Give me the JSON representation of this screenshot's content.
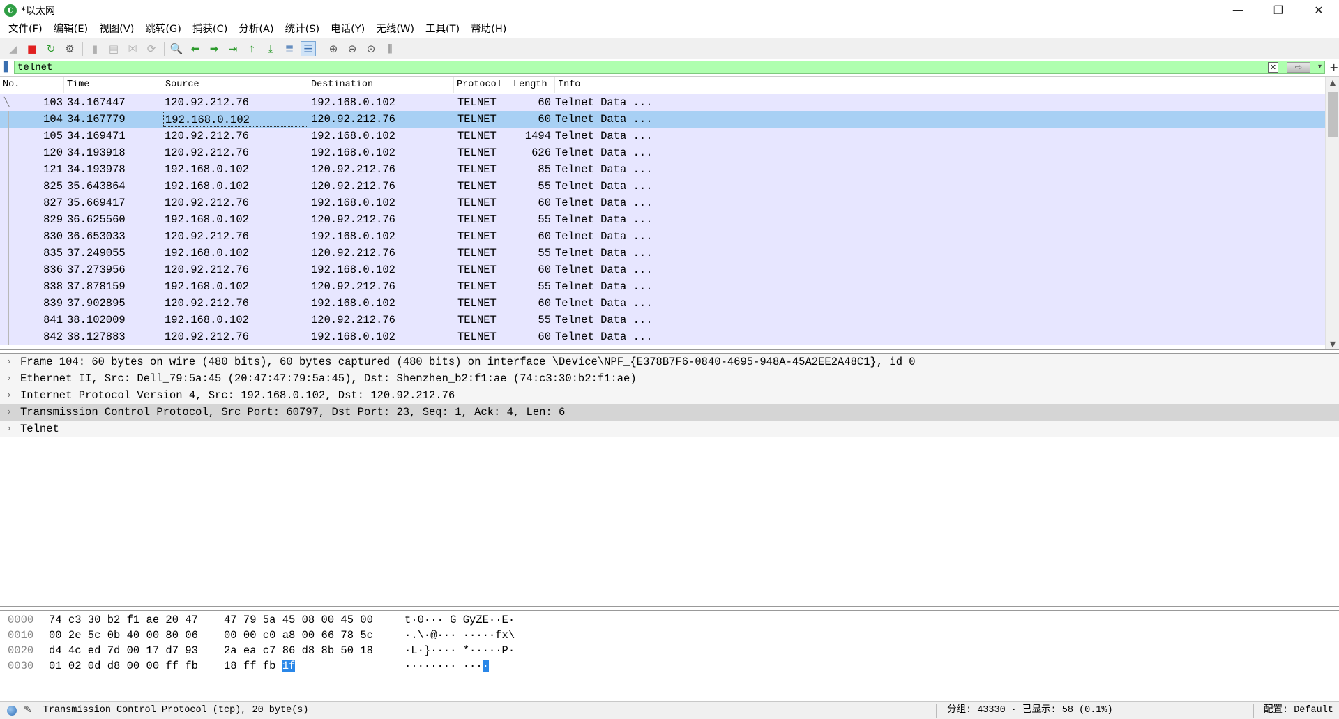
{
  "window": {
    "title": "*以太网",
    "app_icon_glyph": "◐",
    "minimize_glyph": "—",
    "restore_glyph": "❐",
    "close_glyph": "✕"
  },
  "menu": [
    "文件(F)",
    "编辑(E)",
    "视图(V)",
    "跳转(G)",
    "捕获(C)",
    "分析(A)",
    "统计(S)",
    "电话(Y)",
    "无线(W)",
    "工具(T)",
    "帮助(H)"
  ],
  "filter": {
    "value": "telnet",
    "clear_glyph": "✕",
    "apply_glyph": "⇨",
    "dropdown_glyph": "▾",
    "add_glyph": "+"
  },
  "packet_list": {
    "columns": [
      "No.",
      "Time",
      "Source",
      "Destination",
      "Protocol",
      "Length",
      "Info"
    ],
    "rows": [
      {
        "no": "103",
        "time": "34.167447",
        "src": "120.92.212.76",
        "dst": "192.168.0.102",
        "proto": "TELNET",
        "len": "60",
        "info": "Telnet Data ..."
      },
      {
        "no": "104",
        "time": "34.167779",
        "src": "192.168.0.102",
        "dst": "120.92.212.76",
        "proto": "TELNET",
        "len": "60",
        "info": "Telnet Data ..."
      },
      {
        "no": "105",
        "time": "34.169471",
        "src": "120.92.212.76",
        "dst": "192.168.0.102",
        "proto": "TELNET",
        "len": "1494",
        "info": "Telnet Data ..."
      },
      {
        "no": "120",
        "time": "34.193918",
        "src": "120.92.212.76",
        "dst": "192.168.0.102",
        "proto": "TELNET",
        "len": "626",
        "info": "Telnet Data ..."
      },
      {
        "no": "121",
        "time": "34.193978",
        "src": "192.168.0.102",
        "dst": "120.92.212.76",
        "proto": "TELNET",
        "len": "85",
        "info": "Telnet Data ..."
      },
      {
        "no": "825",
        "time": "35.643864",
        "src": "192.168.0.102",
        "dst": "120.92.212.76",
        "proto": "TELNET",
        "len": "55",
        "info": "Telnet Data ..."
      },
      {
        "no": "827",
        "time": "35.669417",
        "src": "120.92.212.76",
        "dst": "192.168.0.102",
        "proto": "TELNET",
        "len": "60",
        "info": "Telnet Data ..."
      },
      {
        "no": "829",
        "time": "36.625560",
        "src": "192.168.0.102",
        "dst": "120.92.212.76",
        "proto": "TELNET",
        "len": "55",
        "info": "Telnet Data ..."
      },
      {
        "no": "830",
        "time": "36.653033",
        "src": "120.92.212.76",
        "dst": "192.168.0.102",
        "proto": "TELNET",
        "len": "60",
        "info": "Telnet Data ..."
      },
      {
        "no": "835",
        "time": "37.249055",
        "src": "192.168.0.102",
        "dst": "120.92.212.76",
        "proto": "TELNET",
        "len": "55",
        "info": "Telnet Data ..."
      },
      {
        "no": "836",
        "time": "37.273956",
        "src": "120.92.212.76",
        "dst": "192.168.0.102",
        "proto": "TELNET",
        "len": "60",
        "info": "Telnet Data ..."
      },
      {
        "no": "838",
        "time": "37.878159",
        "src": "192.168.0.102",
        "dst": "120.92.212.76",
        "proto": "TELNET",
        "len": "55",
        "info": "Telnet Data ..."
      },
      {
        "no": "839",
        "time": "37.902895",
        "src": "120.92.212.76",
        "dst": "192.168.0.102",
        "proto": "TELNET",
        "len": "60",
        "info": "Telnet Data ..."
      },
      {
        "no": "841",
        "time": "38.102009",
        "src": "192.168.0.102",
        "dst": "120.92.212.76",
        "proto": "TELNET",
        "len": "55",
        "info": "Telnet Data ..."
      },
      {
        "no": "842",
        "time": "38.127883",
        "src": "120.92.212.76",
        "dst": "192.168.0.102",
        "proto": "TELNET",
        "len": "60",
        "info": "Telnet Data ..."
      }
    ],
    "selected_index": 1,
    "row_color": "#e7e6ff",
    "selected_color": "#a8d0f4"
  },
  "details": {
    "expander_glyph": "›",
    "rows": [
      "Frame 104: 60 bytes on wire (480 bits), 60 bytes captured (480 bits) on interface \\Device\\NPF_{E378B7F6-0840-4695-948A-45A2EE2A48C1}, id 0",
      "Ethernet II, Src: Dell_79:5a:45 (20:47:47:79:5a:45), Dst: Shenzhen_b2:f1:ae (74:c3:30:b2:f1:ae)",
      "Internet Protocol Version 4, Src: 192.168.0.102, Dst: 120.92.212.76",
      "Transmission Control Protocol, Src Port: 60797, Dst Port: 23, Seq: 1, Ack: 4, Len: 6",
      "Telnet"
    ],
    "highlighted_index": 3
  },
  "bytes": {
    "rows": [
      {
        "offset": "0000",
        "hex1": "74 c3 30 b2 f1 ae 20 47",
        "hex2": "47 79 5a 45 08 00 45 00",
        "ascii": "t·0··· G GyZE··E·"
      },
      {
        "offset": "0010",
        "hex1": "00 2e 5c 0b 40 00 80 06",
        "hex2": "00 00 c0 a8 00 66 78 5c",
        "ascii": "·.\\·@··· ·····fx\\"
      },
      {
        "offset": "0020",
        "hex1": "d4 4c ed 7d 00 17 d7 93",
        "hex2": "2a ea c7 86 d8 8b 50 18",
        "ascii": "·L·}···· *·····P·"
      },
      {
        "offset": "0030",
        "hex1": "01 02 0d d8 00 00 ff fb",
        "hex2": "18 ff fb ",
        "hex_hl": "1f",
        "ascii": "········ ···",
        "ascii_hl": "·"
      }
    ]
  },
  "status": {
    "text": "Transmission Control Protocol (tcp), 20 byte(s)",
    "stats": "分组: 43330 · 已显示: 58 (0.1%)",
    "profile": "配置: Default",
    "edit_glyph": "✎"
  }
}
